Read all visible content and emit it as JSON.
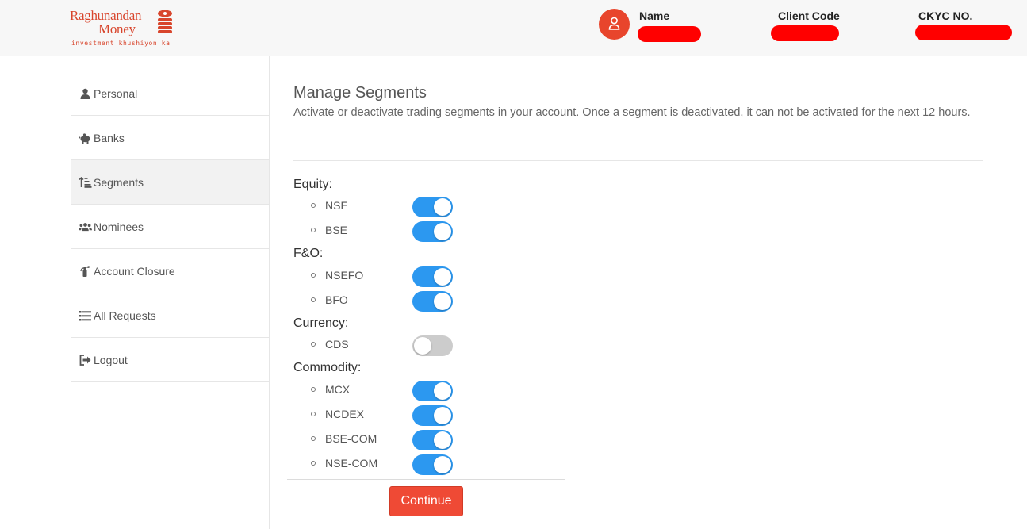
{
  "brand": {
    "name_line1": "Raghunandan",
    "name_line2": "Money",
    "tagline": "investment khushiyon ka",
    "color": "#d8452c"
  },
  "header": {
    "avatar_icon": "user-icon",
    "name_label": "Name",
    "client_code_label": "Client Code",
    "ckyc_label": "CKYC NO."
  },
  "sidebar": {
    "items": [
      {
        "label": "Personal",
        "icon": "user-icon"
      },
      {
        "label": "Banks",
        "icon": "piggy-bank-icon"
      },
      {
        "label": "Segments",
        "icon": "sort-amount-icon",
        "active": true
      },
      {
        "label": "Nominees",
        "icon": "users-icon"
      },
      {
        "label": "Account Closure",
        "icon": "fire-extinguisher-icon"
      },
      {
        "label": "All Requests",
        "icon": "list-icon"
      },
      {
        "label": "Logout",
        "icon": "sign-out-icon"
      }
    ]
  },
  "main": {
    "title": "Manage Segments",
    "description": "Activate or deactivate trading segments in your account. Once a segment is deactivated, it can not be activated for the next 12 hours.",
    "groups": [
      {
        "label": "Equity:",
        "segments": [
          {
            "name": "NSE",
            "enabled": true
          },
          {
            "name": "BSE",
            "enabled": true
          }
        ]
      },
      {
        "label": "F&O:",
        "segments": [
          {
            "name": "NSEFO",
            "enabled": true
          },
          {
            "name": "BFO",
            "enabled": true
          }
        ]
      },
      {
        "label": "Currency:",
        "segments": [
          {
            "name": "CDS",
            "enabled": false
          }
        ]
      },
      {
        "label": "Commodity:",
        "segments": [
          {
            "name": "MCX",
            "enabled": true
          },
          {
            "name": "NCDEX",
            "enabled": true
          },
          {
            "name": "BSE-COM",
            "enabled": true
          },
          {
            "name": "NSE-COM",
            "enabled": true
          }
        ]
      }
    ],
    "continue_label": "Continue"
  },
  "colors": {
    "accent": "#ef4a35",
    "toggle_on": "#2c98f0",
    "toggle_off": "#cccccc"
  }
}
